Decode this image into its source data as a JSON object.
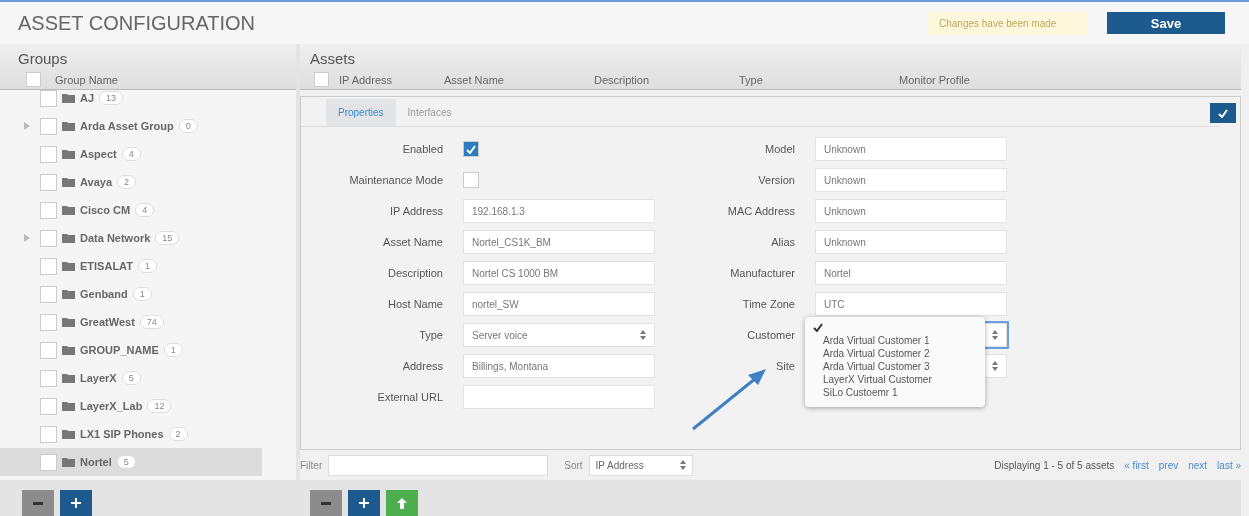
{
  "title": "ASSET CONFIGURATION",
  "notice": "Changes have been made",
  "save_button": "Save",
  "groups": {
    "title": "Groups",
    "column": "Group Name",
    "all_checked": false,
    "items": [
      {
        "name": "AJ",
        "count": "13",
        "expandable": false,
        "selected": false
      },
      {
        "name": "Arda Asset Group",
        "count": "0",
        "expandable": true,
        "selected": false
      },
      {
        "name": "Aspect",
        "count": "4",
        "expandable": false,
        "selected": false
      },
      {
        "name": "Avaya",
        "count": "2",
        "expandable": false,
        "selected": false
      },
      {
        "name": "Cisco CM",
        "count": "4",
        "expandable": false,
        "selected": false
      },
      {
        "name": "Data Network",
        "count": "15",
        "expandable": true,
        "selected": false
      },
      {
        "name": "ETISALAT",
        "count": "1",
        "expandable": false,
        "selected": false
      },
      {
        "name": "Genband",
        "count": "1",
        "expandable": false,
        "selected": false
      },
      {
        "name": "GreatWest",
        "count": "74",
        "expandable": false,
        "selected": false
      },
      {
        "name": "GROUP_NAME",
        "count": "1",
        "expandable": false,
        "selected": false
      },
      {
        "name": "LayerX",
        "count": "5",
        "expandable": false,
        "selected": false
      },
      {
        "name": "LayerX_Lab",
        "count": "12",
        "expandable": false,
        "selected": false
      },
      {
        "name": "LX1 SIP Phones",
        "count": "2",
        "expandable": false,
        "selected": false
      },
      {
        "name": "Nortel",
        "count": "5",
        "expandable": false,
        "selected": true
      }
    ],
    "buttons": [
      {
        "kind": "remove"
      },
      {
        "kind": "add"
      }
    ]
  },
  "assets": {
    "title": "Assets",
    "all_checked": false,
    "columns": [
      "IP Address",
      "Asset Name",
      "Description",
      "Type",
      "Monitor Profile"
    ],
    "tabs": [
      {
        "label": "Properties",
        "selected": true
      },
      {
        "label": "Interfaces",
        "selected": false
      }
    ],
    "form_left": [
      {
        "label": "Enabled",
        "kind": "checkbox",
        "checked": true
      },
      {
        "label": "Maintenance Mode",
        "kind": "checkbox",
        "checked": false
      },
      {
        "label": "IP Address",
        "kind": "text",
        "value": "192.168.1.3"
      },
      {
        "label": "Asset Name",
        "kind": "text",
        "value": "Nortel_CS1K_BM"
      },
      {
        "label": "Description",
        "kind": "text",
        "value": "Nortel CS 1000 BM"
      },
      {
        "label": "Host Name",
        "kind": "text",
        "value": "nortel_SW"
      },
      {
        "label": "Type",
        "kind": "select",
        "value": "Server voice",
        "open": false
      },
      {
        "label": "Address",
        "kind": "text",
        "value": "Billings, Montana"
      },
      {
        "label": "External URL",
        "kind": "text"
      }
    ],
    "form_right": [
      {
        "label": "Model",
        "kind": "text",
        "value": "Unknown"
      },
      {
        "label": "Version",
        "kind": "text",
        "value": "Unknown"
      },
      {
        "label": "MAC Address",
        "kind": "text",
        "value": "Unknown"
      },
      {
        "label": "Alias",
        "kind": "text",
        "value": "Unknown"
      },
      {
        "label": "Manufacturer",
        "kind": "text",
        "value": "Nortel"
      },
      {
        "label": "Time Zone",
        "kind": "text",
        "value": "UTC"
      },
      {
        "label": "Customer",
        "kind": "select",
        "open": true,
        "options": [
          {
            "kind": "blank",
            "selected": true
          },
          {
            "kind": "text",
            "label": "Arda Virtual Customer 1",
            "selected": false
          },
          {
            "kind": "text",
            "label": "Arda Virtual Customer 2",
            "selected": false
          },
          {
            "kind": "text",
            "label": "Arda Virtual Customer 3",
            "selected": false
          },
          {
            "kind": "text",
            "label": "LayerX Virtual Customer",
            "selected": false
          },
          {
            "kind": "text",
            "label": "SiLo Custoemr 1",
            "selected": false
          }
        ]
      },
      {
        "label": "Site",
        "kind": "select",
        "open": false
      }
    ],
    "filter_label": "Filter",
    "sort_label": "Sort",
    "sort_value": "IP Address",
    "status": "Displaying 1 - 5 of 5 assets",
    "links": [
      "« first",
      "prev",
      "next",
      "last »"
    ],
    "buttons": [
      {
        "kind": "remove"
      },
      {
        "kind": "add"
      },
      {
        "kind": "upload"
      }
    ]
  }
}
